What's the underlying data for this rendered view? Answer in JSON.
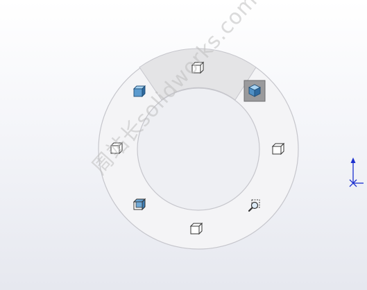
{
  "watermark": {
    "text": "周站长solidworks.com"
  },
  "ring_menu": {
    "items": [
      {
        "name": "view-top-icon",
        "selected": true
      },
      {
        "name": "view-isometric-icon",
        "highlighted": true
      },
      {
        "name": "view-right-icon"
      },
      {
        "name": "zoom-to-selection-icon"
      },
      {
        "name": "view-bottom-icon"
      },
      {
        "name": "view-dimetric-icon"
      },
      {
        "name": "view-left-icon"
      },
      {
        "name": "view-trimetric-icon"
      }
    ]
  },
  "colors": {
    "ring_fill": "#f4f4f6",
    "ring_stroke": "#c6c6cc",
    "selected_sector": "#e4e4e6",
    "highlight_bg": "#9a9a9c",
    "cube_blue": "#6fa8d6",
    "triad_blue": "#1a2ecf"
  }
}
